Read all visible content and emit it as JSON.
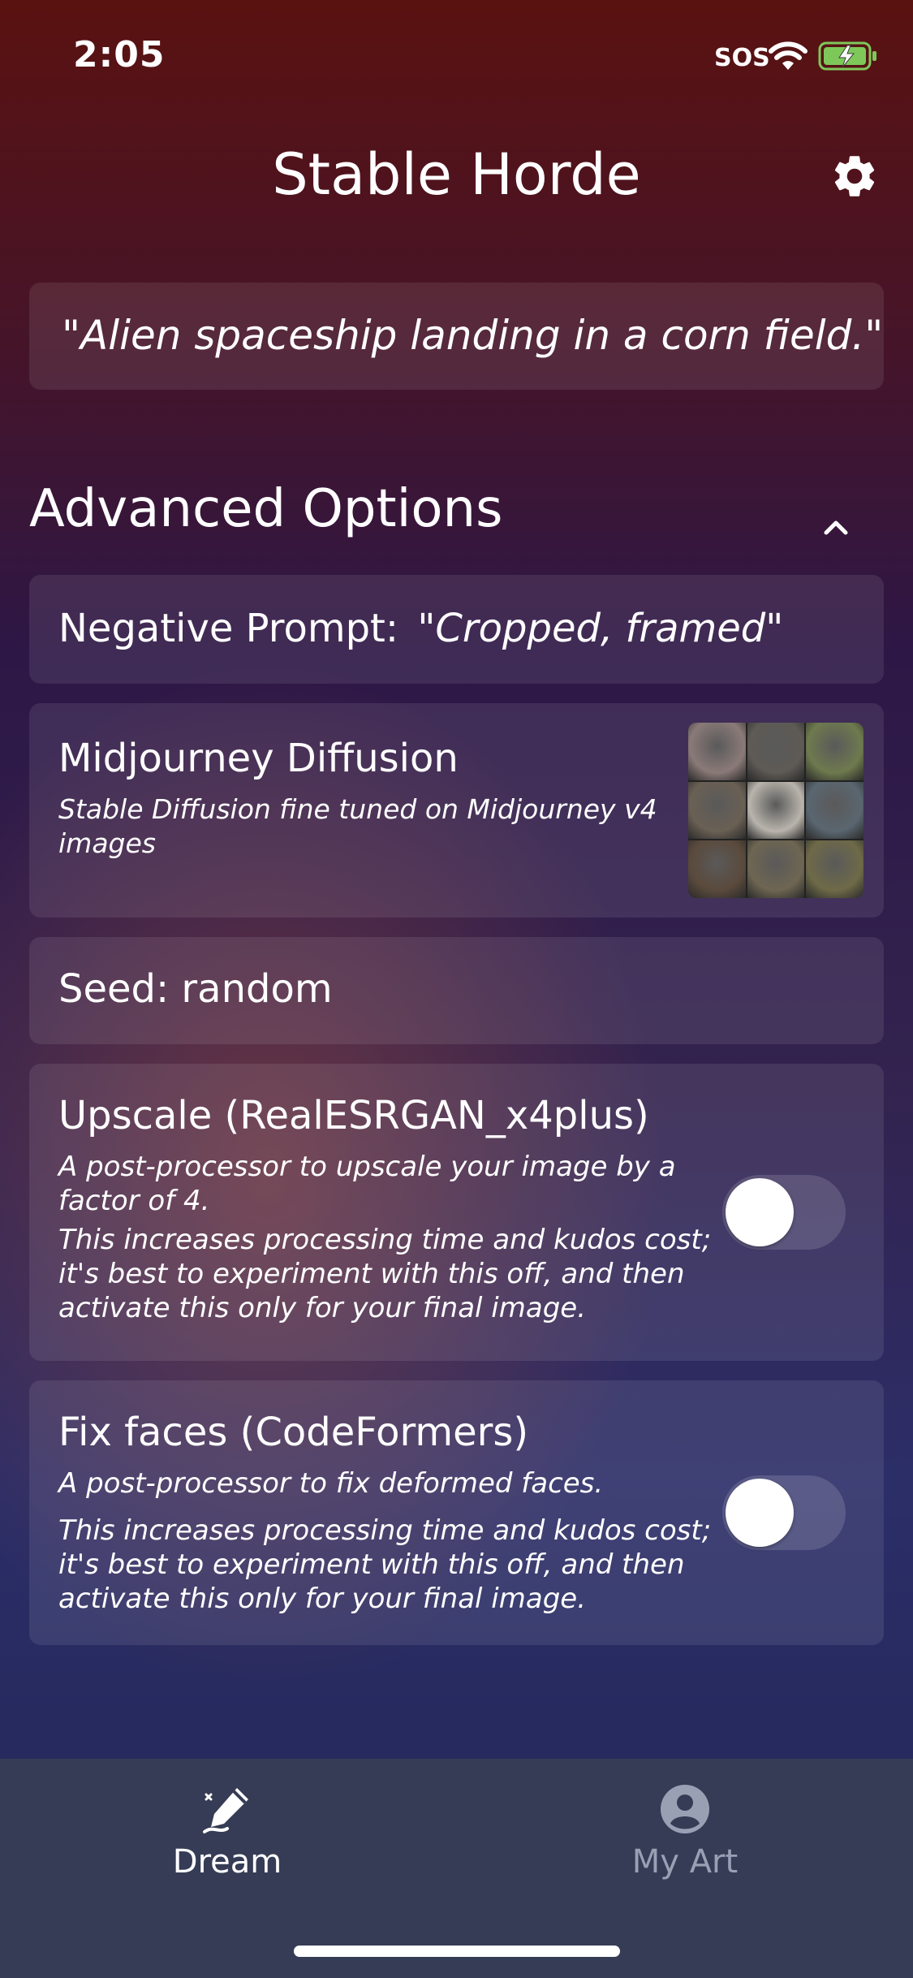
{
  "status_bar": {
    "time": "2:05",
    "sos": "SOS"
  },
  "header": {
    "title": "Stable Horde"
  },
  "prompt": {
    "text": "\"Alien spaceship landing in a corn field.\""
  },
  "advanced": {
    "title": "Advanced Options",
    "negative_prompt": {
      "label": "Negative Prompt:",
      "value": "\"Cropped, framed\""
    },
    "model": {
      "name": "Midjourney Diffusion",
      "description": "Stable Diffusion fine tuned on Midjourney v4 images",
      "thumbnail_colors": [
        "#8a7a78",
        "#5e5a55",
        "#6e7a4e",
        "#6a6054",
        "#b9b4ac",
        "#5a6670",
        "#5a4a3c",
        "#6e6652",
        "#6e6a48"
      ]
    },
    "seed": {
      "label": "Seed: random"
    },
    "upscale": {
      "title": "Upscale (RealESRGAN_x4plus)",
      "desc1": "A post-processor to upscale your image by a factor of 4.",
      "desc2": "This increases processing time and kudos cost; it's best to experiment with this off, and then activate this only for your final image.",
      "enabled": false
    },
    "fix_faces": {
      "title": "Fix faces (CodeFormers)",
      "desc1": "A post-processor to fix deformed faces.",
      "desc2": "This increases processing time and kudos cost; it's best to experiment with this off, and then activate this only for your final image.",
      "enabled": false
    }
  },
  "tabbar": {
    "tabs": [
      {
        "label": "Dream",
        "icon": "pencil-draw-icon",
        "active": true
      },
      {
        "label": "My Art",
        "icon": "user-circle-icon",
        "active": false
      }
    ]
  }
}
